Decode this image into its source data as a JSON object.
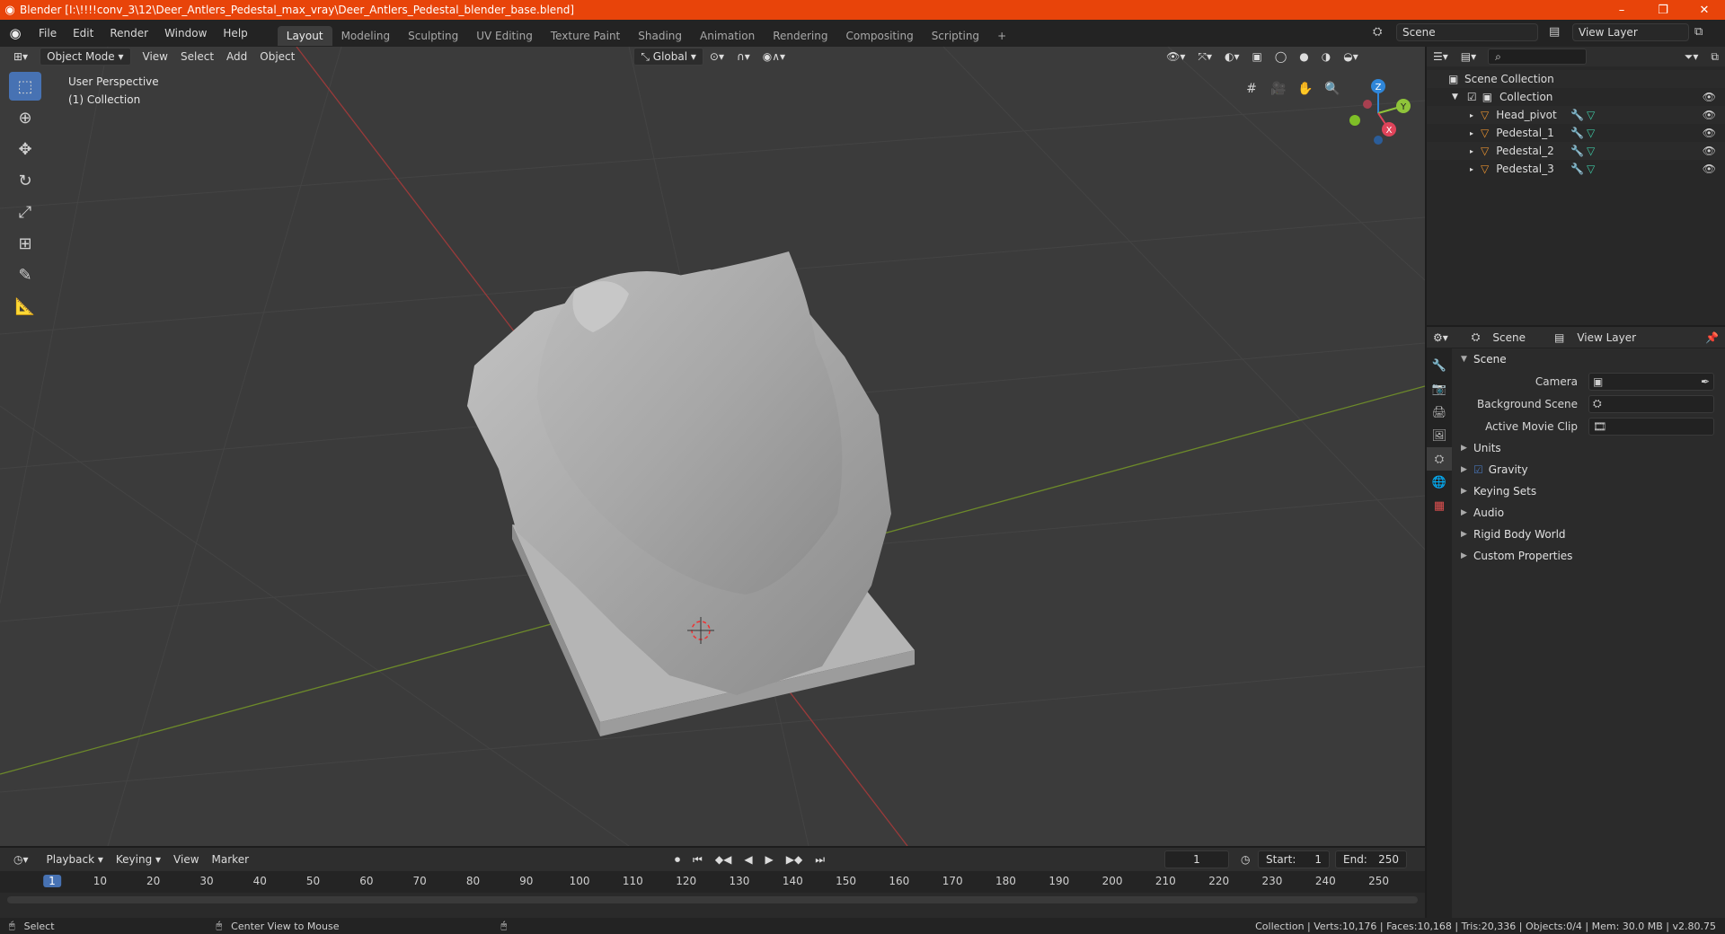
{
  "window": {
    "title": "Blender [I:\\!!!!conv_3\\12\\Deer_Antlers_Pedestal_max_vray\\Deer_Antlers_Pedestal_blender_base.blend]",
    "minimize": "–",
    "maximize": "❐",
    "close": "✕"
  },
  "menu": {
    "items": [
      "File",
      "Edit",
      "Render",
      "Window",
      "Help"
    ]
  },
  "workspaces": [
    "Layout",
    "Modeling",
    "Sculpting",
    "UV Editing",
    "Texture Paint",
    "Shading",
    "Animation",
    "Rendering",
    "Compositing",
    "Scripting"
  ],
  "workspace_add": "+",
  "scene_selector": {
    "value": "Scene"
  },
  "view_layer_selector": {
    "value": "View Layer"
  },
  "viewport": {
    "mode": "Object Mode",
    "menus": [
      "View",
      "Select",
      "Add",
      "Object"
    ],
    "transform_orientation": "Global",
    "overlay_title": "User Perspective",
    "overlay_collection": "(1) Collection",
    "gizmo": {
      "z": "Z",
      "y": "Y",
      "x": "X"
    }
  },
  "outliner": {
    "root": "Scene Collection",
    "collection": "Collection",
    "objects": [
      "Head_pivot",
      "Pedestal_1",
      "Pedestal_2",
      "Pedestal_3"
    ]
  },
  "properties": {
    "tab_scene": "Scene",
    "tab_view_layer": "View Layer",
    "panel_title": "Scene",
    "camera_label": "Camera",
    "background_scene_label": "Background Scene",
    "active_movie_clip_label": "Active Movie Clip",
    "subpanels": [
      "Units",
      "Gravity",
      "Keying Sets",
      "Audio",
      "Rigid Body World",
      "Custom Properties"
    ]
  },
  "timeline": {
    "menus": [
      "Playback",
      "Keying",
      "View",
      "Marker"
    ],
    "current_frame": "1",
    "start_label": "Start:",
    "start_value": "1",
    "end_label": "End:",
    "end_value": "250",
    "ticks": [
      "1",
      "10",
      "20",
      "30",
      "40",
      "50",
      "60",
      "70",
      "80",
      "90",
      "100",
      "110",
      "120",
      "130",
      "140",
      "150",
      "160",
      "170",
      "180",
      "190",
      "200",
      "210",
      "220",
      "230",
      "240",
      "250"
    ]
  },
  "status": {
    "select": "Select",
    "center_view": "Center View to Mouse",
    "stats": "Collection | Verts:10,176 | Faces:10,168 | Tris:20,336 | Objects:0/4 | Mem: 30.0 MB | v2.80.75"
  },
  "colors": {
    "titlebar": "#e8440a",
    "accent": "#4772b3",
    "x_axis": "#e0445a",
    "y_axis": "#8fc43a",
    "z_axis": "#2f86d9"
  }
}
